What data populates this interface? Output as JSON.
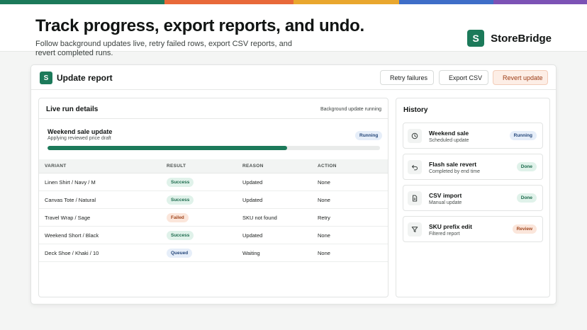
{
  "colors": {
    "stripe": [
      "#1c7a5a",
      "#e8693a",
      "#e9a72e",
      "#3f6ec8",
      "#7c52b5"
    ],
    "brand": "#1c7a5a",
    "accent_warning": "#fdeee6"
  },
  "hero": {
    "title": "Track progress, export reports, and undo.",
    "subtitle": "Follow background updates live, retry failed rows, export CSV reports, and revert completed runs.",
    "brand_logo": "S",
    "brand_name": "StoreBridge"
  },
  "card": {
    "logo": "S",
    "title": "Update report",
    "buttons": {
      "retry": "Retry failures",
      "export": "Export CSV",
      "revert": "Revert update"
    }
  },
  "live": {
    "title": "Live run details",
    "status": "Background update running",
    "job": {
      "name": "Weekend sale update",
      "description": "Applying reviewed price draft",
      "badge": "Running",
      "progress_percent": 72
    },
    "table": {
      "headers": [
        "VARIANT",
        "RESULT",
        "REASON",
        "ACTION"
      ],
      "rows": [
        {
          "variant": "Linen Shirt / Navy / M",
          "result": "Success",
          "result_type": "success",
          "reason": "Updated",
          "action": "None"
        },
        {
          "variant": "Canvas Tote / Natural",
          "result": "Success",
          "result_type": "success",
          "reason": "Updated",
          "action": "None"
        },
        {
          "variant": "Travel Wrap / Sage",
          "result": "Failed",
          "result_type": "failed",
          "reason": "SKU not found",
          "action": "Retry"
        },
        {
          "variant": "Weekend Short / Black",
          "result": "Success",
          "result_type": "success",
          "reason": "Updated",
          "action": "None"
        },
        {
          "variant": "Deck Shoe / Khaki / 10",
          "result": "Queued",
          "result_type": "queued",
          "reason": "Waiting",
          "action": "None"
        }
      ]
    }
  },
  "history": {
    "title": "History",
    "items": [
      {
        "name": "Weekend sale",
        "description": "Scheduled update",
        "badge": "Running",
        "badge_type": "running",
        "icon": "clock-icon"
      },
      {
        "name": "Flash sale revert",
        "description": "Completed by end time",
        "badge": "Done",
        "badge_type": "done",
        "icon": "undo-icon"
      },
      {
        "name": "CSV import",
        "description": "Manual update",
        "badge": "Done",
        "badge_type": "done",
        "icon": "file-icon"
      },
      {
        "name": "SKU prefix edit",
        "description": "Filtered report",
        "badge": "Review",
        "badge_type": "review",
        "icon": "filter-icon"
      }
    ]
  }
}
